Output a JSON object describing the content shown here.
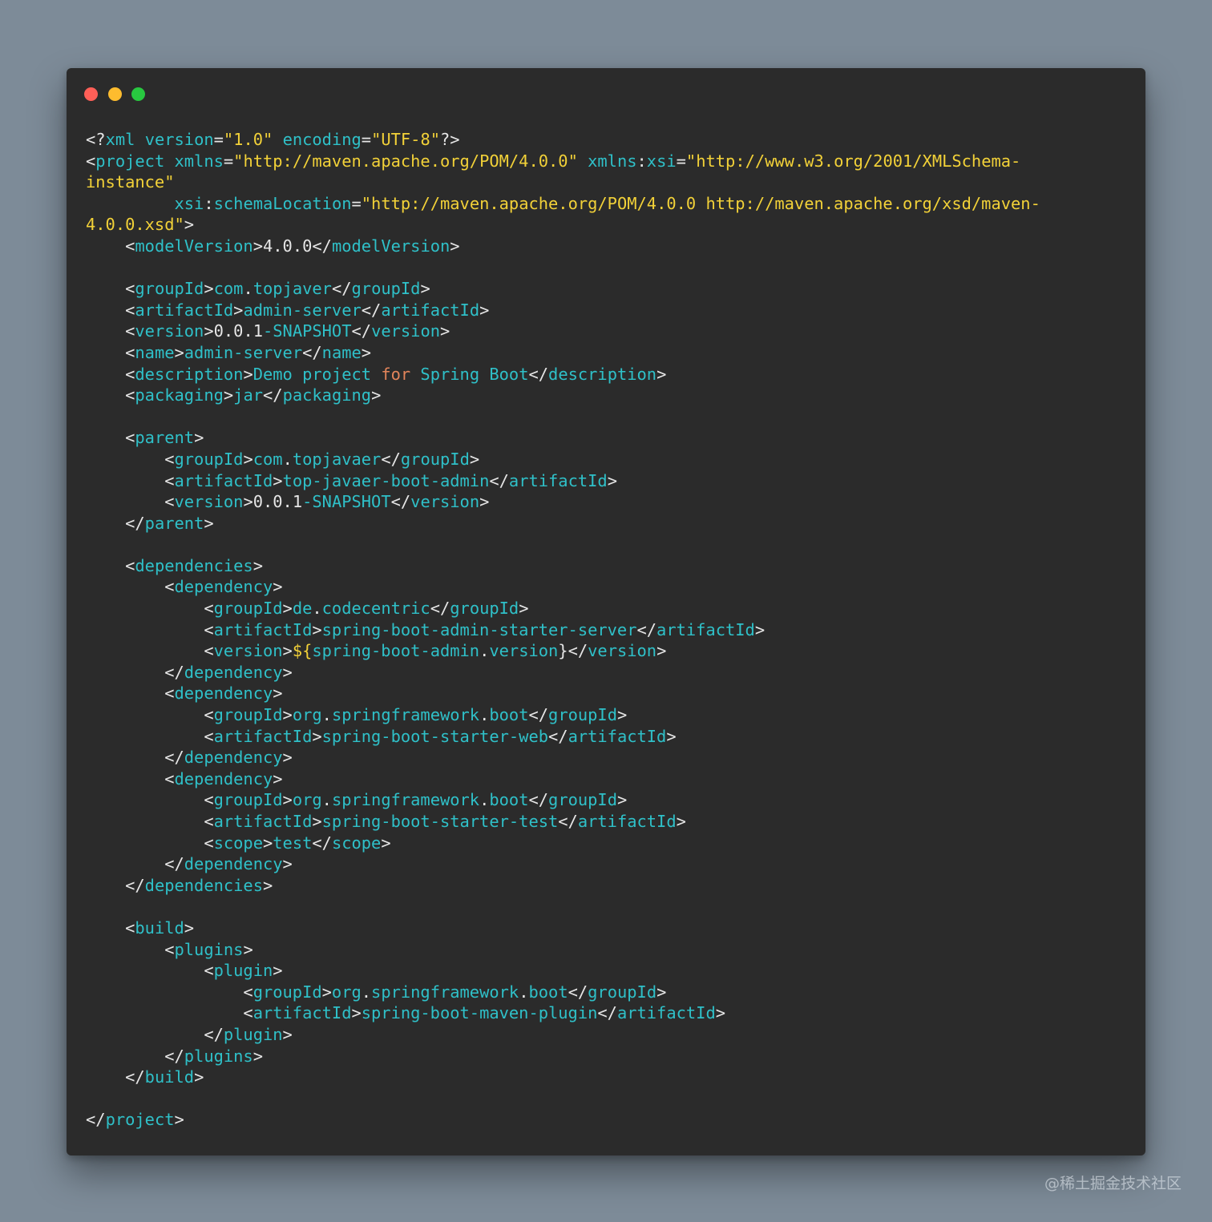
{
  "window": {
    "controls": [
      "close",
      "minimize",
      "zoom"
    ],
    "control_colors": {
      "close": "#ff5f57",
      "minimize": "#febc2e",
      "zoom": "#28c840"
    },
    "background_color": "#2b2b2b"
  },
  "syntax_colors": {
    "tag": "#2fc0c8",
    "string": "#f2d138",
    "punctuation": "#e6e6e6",
    "keyword": "#e2845a"
  },
  "code": {
    "language": "xml",
    "lines": [
      [
        [
          "pun",
          "<?"
        ],
        [
          "tag",
          "xml"
        ],
        [
          "pun",
          " "
        ],
        [
          "tag",
          "version"
        ],
        [
          "pun",
          "="
        ],
        [
          "str",
          "\"1.0\""
        ],
        [
          "pun",
          " "
        ],
        [
          "tag",
          "encoding"
        ],
        [
          "pun",
          "="
        ],
        [
          "str",
          "\"UTF-8\""
        ],
        [
          "pun",
          "?>"
        ]
      ],
      [
        [
          "pun",
          "<"
        ],
        [
          "tag",
          "project"
        ],
        [
          "pun",
          " "
        ],
        [
          "tag",
          "xmlns"
        ],
        [
          "pun",
          "="
        ],
        [
          "str",
          "\"http://maven.apache.org/POM/4.0.0\""
        ],
        [
          "pun",
          " "
        ],
        [
          "tag",
          "xmlns"
        ],
        [
          "pun",
          ":"
        ],
        [
          "tag",
          "xsi"
        ],
        [
          "pun",
          "="
        ],
        [
          "str",
          "\"http://www.w3.org/2001/XMLSchema-"
        ]
      ],
      [
        [
          "str",
          "instance\""
        ]
      ],
      [
        [
          "pun",
          "         "
        ],
        [
          "tag",
          "xsi"
        ],
        [
          "pun",
          ":"
        ],
        [
          "tag",
          "schemaLocation"
        ],
        [
          "pun",
          "="
        ],
        [
          "str",
          "\"http://maven.apache.org/POM/4.0.0 http://maven.apache.org/xsd/maven-"
        ]
      ],
      [
        [
          "str",
          "4.0.0.xsd\""
        ],
        [
          "pun",
          ">"
        ]
      ],
      [
        [
          "pun",
          "    <"
        ],
        [
          "tag",
          "modelVersion"
        ],
        [
          "pun",
          ">"
        ],
        [
          "num",
          "4.0.0"
        ],
        [
          "pun",
          "</"
        ],
        [
          "tag",
          "modelVersion"
        ],
        [
          "pun",
          ">"
        ]
      ],
      [],
      [
        [
          "pun",
          "    <"
        ],
        [
          "tag",
          "groupId"
        ],
        [
          "pun",
          ">"
        ],
        [
          "txt",
          "com"
        ],
        [
          "pun",
          "."
        ],
        [
          "txt",
          "topjaver"
        ],
        [
          "pun",
          "</"
        ],
        [
          "tag",
          "groupId"
        ],
        [
          "pun",
          ">"
        ]
      ],
      [
        [
          "pun",
          "    <"
        ],
        [
          "tag",
          "artifactId"
        ],
        [
          "pun",
          ">"
        ],
        [
          "txt",
          "admin-server"
        ],
        [
          "pun",
          "</"
        ],
        [
          "tag",
          "artifactId"
        ],
        [
          "pun",
          ">"
        ]
      ],
      [
        [
          "pun",
          "    <"
        ],
        [
          "tag",
          "version"
        ],
        [
          "pun",
          ">"
        ],
        [
          "num",
          "0.0.1"
        ],
        [
          "txt",
          "-SNAPSHOT"
        ],
        [
          "pun",
          "</"
        ],
        [
          "tag",
          "version"
        ],
        [
          "pun",
          ">"
        ]
      ],
      [
        [
          "pun",
          "    <"
        ],
        [
          "tag",
          "name"
        ],
        [
          "pun",
          ">"
        ],
        [
          "txt",
          "admin-server"
        ],
        [
          "pun",
          "</"
        ],
        [
          "tag",
          "name"
        ],
        [
          "pun",
          ">"
        ]
      ],
      [
        [
          "pun",
          "    <"
        ],
        [
          "tag",
          "description"
        ],
        [
          "pun",
          ">"
        ],
        [
          "txt",
          "Demo project "
        ],
        [
          "kw",
          "for"
        ],
        [
          "txt",
          " Spring Boot"
        ],
        [
          "pun",
          "</"
        ],
        [
          "tag",
          "description"
        ],
        [
          "pun",
          ">"
        ]
      ],
      [
        [
          "pun",
          "    <"
        ],
        [
          "tag",
          "packaging"
        ],
        [
          "pun",
          ">"
        ],
        [
          "txt",
          "jar"
        ],
        [
          "pun",
          "</"
        ],
        [
          "tag",
          "packaging"
        ],
        [
          "pun",
          ">"
        ]
      ],
      [],
      [
        [
          "pun",
          "    <"
        ],
        [
          "tag",
          "parent"
        ],
        [
          "pun",
          ">"
        ]
      ],
      [
        [
          "pun",
          "        <"
        ],
        [
          "tag",
          "groupId"
        ],
        [
          "pun",
          ">"
        ],
        [
          "txt",
          "com"
        ],
        [
          "pun",
          "."
        ],
        [
          "txt",
          "topjavaer"
        ],
        [
          "pun",
          "</"
        ],
        [
          "tag",
          "groupId"
        ],
        [
          "pun",
          ">"
        ]
      ],
      [
        [
          "pun",
          "        <"
        ],
        [
          "tag",
          "artifactId"
        ],
        [
          "pun",
          ">"
        ],
        [
          "txt",
          "top-javaer-boot-admin"
        ],
        [
          "pun",
          "</"
        ],
        [
          "tag",
          "artifactId"
        ],
        [
          "pun",
          ">"
        ]
      ],
      [
        [
          "pun",
          "        <"
        ],
        [
          "tag",
          "version"
        ],
        [
          "pun",
          ">"
        ],
        [
          "num",
          "0.0.1"
        ],
        [
          "txt",
          "-SNAPSHOT"
        ],
        [
          "pun",
          "</"
        ],
        [
          "tag",
          "version"
        ],
        [
          "pun",
          ">"
        ]
      ],
      [
        [
          "pun",
          "    </"
        ],
        [
          "tag",
          "parent"
        ],
        [
          "pun",
          ">"
        ]
      ],
      [],
      [
        [
          "pun",
          "    <"
        ],
        [
          "tag",
          "dependencies"
        ],
        [
          "pun",
          ">"
        ]
      ],
      [
        [
          "pun",
          "        <"
        ],
        [
          "tag",
          "dependency"
        ],
        [
          "pun",
          ">"
        ]
      ],
      [
        [
          "pun",
          "            <"
        ],
        [
          "tag",
          "groupId"
        ],
        [
          "pun",
          ">"
        ],
        [
          "txt",
          "de"
        ],
        [
          "pun",
          "."
        ],
        [
          "txt",
          "codecentric"
        ],
        [
          "pun",
          "</"
        ],
        [
          "tag",
          "groupId"
        ],
        [
          "pun",
          ">"
        ]
      ],
      [
        [
          "pun",
          "            <"
        ],
        [
          "tag",
          "artifactId"
        ],
        [
          "pun",
          ">"
        ],
        [
          "txt",
          "spring-boot-admin-starter-server"
        ],
        [
          "pun",
          "</"
        ],
        [
          "tag",
          "artifactId"
        ],
        [
          "pun",
          ">"
        ]
      ],
      [
        [
          "pun",
          "            <"
        ],
        [
          "tag",
          "version"
        ],
        [
          "pun",
          ">"
        ],
        [
          "str",
          "${"
        ],
        [
          "txt",
          "spring-boot-admin"
        ],
        [
          "pun",
          "."
        ],
        [
          "txt",
          "version"
        ],
        [
          "pun",
          "}</"
        ],
        [
          "tag",
          "version"
        ],
        [
          "pun",
          ">"
        ]
      ],
      [
        [
          "pun",
          "        </"
        ],
        [
          "tag",
          "dependency"
        ],
        [
          "pun",
          ">"
        ]
      ],
      [
        [
          "pun",
          "        <"
        ],
        [
          "tag",
          "dependency"
        ],
        [
          "pun",
          ">"
        ]
      ],
      [
        [
          "pun",
          "            <"
        ],
        [
          "tag",
          "groupId"
        ],
        [
          "pun",
          ">"
        ],
        [
          "txt",
          "org"
        ],
        [
          "pun",
          "."
        ],
        [
          "txt",
          "springframework"
        ],
        [
          "pun",
          "."
        ],
        [
          "txt",
          "boot"
        ],
        [
          "pun",
          "</"
        ],
        [
          "tag",
          "groupId"
        ],
        [
          "pun",
          ">"
        ]
      ],
      [
        [
          "pun",
          "            <"
        ],
        [
          "tag",
          "artifactId"
        ],
        [
          "pun",
          ">"
        ],
        [
          "txt",
          "spring-boot-starter-web"
        ],
        [
          "pun",
          "</"
        ],
        [
          "tag",
          "artifactId"
        ],
        [
          "pun",
          ">"
        ]
      ],
      [
        [
          "pun",
          "        </"
        ],
        [
          "tag",
          "dependency"
        ],
        [
          "pun",
          ">"
        ]
      ],
      [
        [
          "pun",
          "        <"
        ],
        [
          "tag",
          "dependency"
        ],
        [
          "pun",
          ">"
        ]
      ],
      [
        [
          "pun",
          "            <"
        ],
        [
          "tag",
          "groupId"
        ],
        [
          "pun",
          ">"
        ],
        [
          "txt",
          "org"
        ],
        [
          "pun",
          "."
        ],
        [
          "txt",
          "springframework"
        ],
        [
          "pun",
          "."
        ],
        [
          "txt",
          "boot"
        ],
        [
          "pun",
          "</"
        ],
        [
          "tag",
          "groupId"
        ],
        [
          "pun",
          ">"
        ]
      ],
      [
        [
          "pun",
          "            <"
        ],
        [
          "tag",
          "artifactId"
        ],
        [
          "pun",
          ">"
        ],
        [
          "txt",
          "spring-boot-starter-test"
        ],
        [
          "pun",
          "</"
        ],
        [
          "tag",
          "artifactId"
        ],
        [
          "pun",
          ">"
        ]
      ],
      [
        [
          "pun",
          "            <"
        ],
        [
          "tag",
          "scope"
        ],
        [
          "pun",
          ">"
        ],
        [
          "txt",
          "test"
        ],
        [
          "pun",
          "</"
        ],
        [
          "tag",
          "scope"
        ],
        [
          "pun",
          ">"
        ]
      ],
      [
        [
          "pun",
          "        </"
        ],
        [
          "tag",
          "dependency"
        ],
        [
          "pun",
          ">"
        ]
      ],
      [
        [
          "pun",
          "    </"
        ],
        [
          "tag",
          "dependencies"
        ],
        [
          "pun",
          ">"
        ]
      ],
      [],
      [
        [
          "pun",
          "    <"
        ],
        [
          "tag",
          "build"
        ],
        [
          "pun",
          ">"
        ]
      ],
      [
        [
          "pun",
          "        <"
        ],
        [
          "tag",
          "plugins"
        ],
        [
          "pun",
          ">"
        ]
      ],
      [
        [
          "pun",
          "            <"
        ],
        [
          "tag",
          "plugin"
        ],
        [
          "pun",
          ">"
        ]
      ],
      [
        [
          "pun",
          "                <"
        ],
        [
          "tag",
          "groupId"
        ],
        [
          "pun",
          ">"
        ],
        [
          "txt",
          "org"
        ],
        [
          "pun",
          "."
        ],
        [
          "txt",
          "springframework"
        ],
        [
          "pun",
          "."
        ],
        [
          "txt",
          "boot"
        ],
        [
          "pun",
          "</"
        ],
        [
          "tag",
          "groupId"
        ],
        [
          "pun",
          ">"
        ]
      ],
      [
        [
          "pun",
          "                <"
        ],
        [
          "tag",
          "artifactId"
        ],
        [
          "pun",
          ">"
        ],
        [
          "txt",
          "spring-boot-maven-plugin"
        ],
        [
          "pun",
          "</"
        ],
        [
          "tag",
          "artifactId"
        ],
        [
          "pun",
          ">"
        ]
      ],
      [
        [
          "pun",
          "            </"
        ],
        [
          "tag",
          "plugin"
        ],
        [
          "pun",
          ">"
        ]
      ],
      [
        [
          "pun",
          "        </"
        ],
        [
          "tag",
          "plugins"
        ],
        [
          "pun",
          ">"
        ]
      ],
      [
        [
          "pun",
          "    </"
        ],
        [
          "tag",
          "build"
        ],
        [
          "pun",
          ">"
        ]
      ],
      [],
      [
        [
          "pun",
          "</"
        ],
        [
          "tag",
          "project"
        ],
        [
          "pun",
          ">"
        ]
      ]
    ]
  },
  "watermark": "@稀土掘金技术社区"
}
